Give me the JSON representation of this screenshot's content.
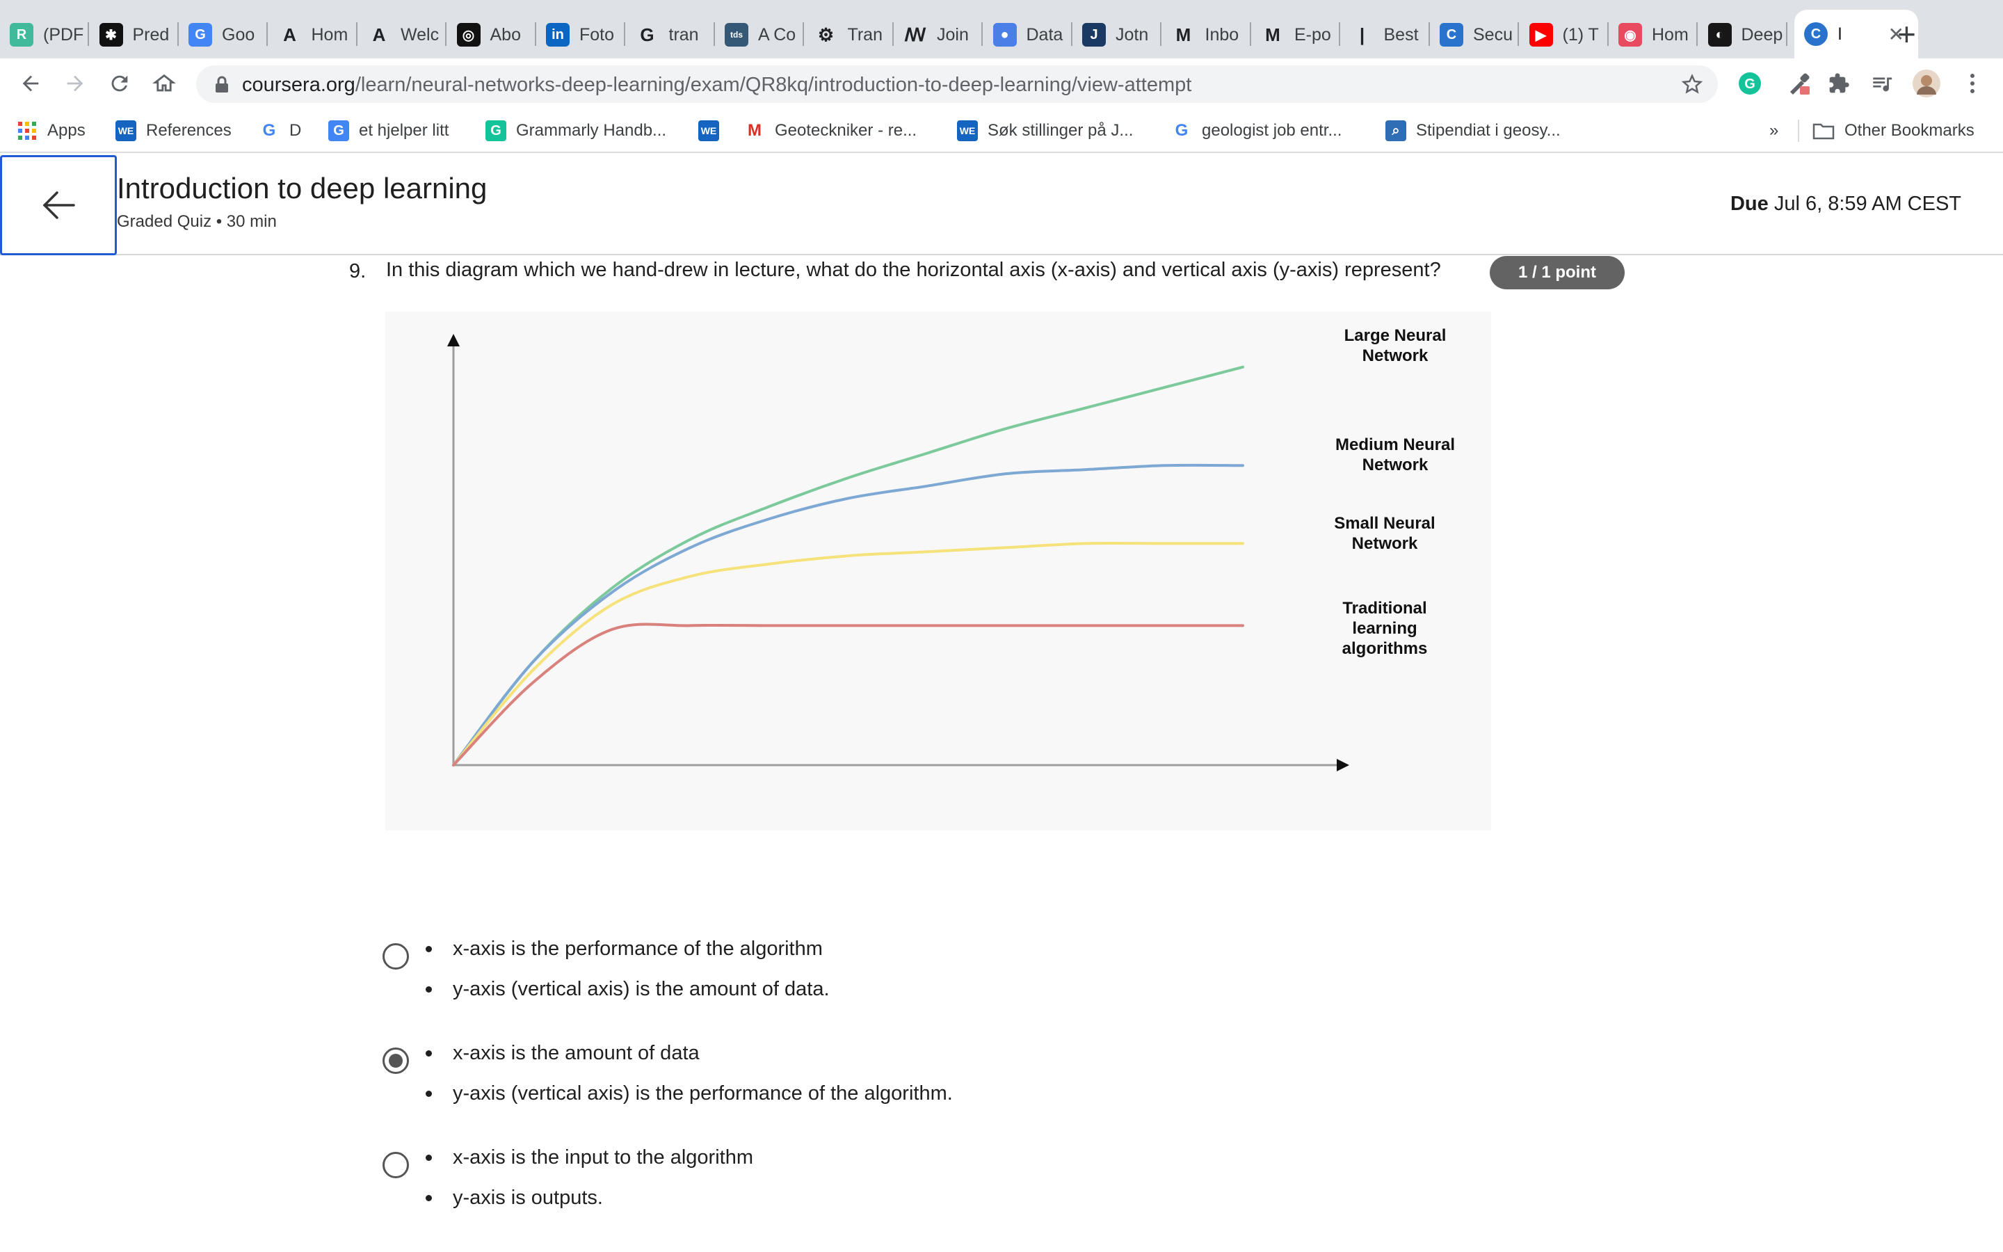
{
  "tabs": [
    {
      "label": "(PDF",
      "icon": "researchgate-icon",
      "color": "#40ba9b",
      "glyph": "R"
    },
    {
      "label": "Pred",
      "icon": "gear-icon",
      "color": "#111111",
      "glyph": "✱"
    },
    {
      "label": "Goo",
      "icon": "google-translate-icon",
      "color": "#4285f4",
      "glyph": "G"
    },
    {
      "label": "Hom",
      "icon": "a-icon",
      "color": "#ffffff",
      "glyph": "A"
    },
    {
      "label": "Welc",
      "icon": "a-icon",
      "color": "#ffffff",
      "glyph": "A"
    },
    {
      "label": "Abo",
      "icon": "openai-icon",
      "color": "#111111",
      "glyph": "◎"
    },
    {
      "label": "Foto",
      "icon": "linkedin-icon",
      "color": "#0a66c2",
      "glyph": "in"
    },
    {
      "label": "tran",
      "icon": "google-icon",
      "color": "#ffffff",
      "glyph": "G"
    },
    {
      "label": "A Co",
      "icon": "tds-icon",
      "color": "#355876",
      "glyph": "tds"
    },
    {
      "label": "Tran",
      "icon": "robot-icon",
      "color": "#ffffff",
      "glyph": "⚙"
    },
    {
      "label": "Join",
      "icon": "s-icon",
      "color": "#ffffff",
      "glyph": "ꟿ"
    },
    {
      "label": "Data",
      "icon": "drop-icon",
      "color": "#4a7fe8",
      "glyph": "●"
    },
    {
      "label": "Jotn",
      "icon": "j-icon",
      "color": "#1b3a63",
      "glyph": "J"
    },
    {
      "label": "Inbo",
      "icon": "gmail-icon",
      "color": "#ffffff",
      "glyph": "M"
    },
    {
      "label": "E-po",
      "icon": "gmail-icon",
      "color": "#ffffff",
      "glyph": "M"
    },
    {
      "label": "Best",
      "icon": "chart-icon",
      "color": "#ffffff",
      "glyph": "|"
    },
    {
      "label": "Secu",
      "icon": "coursera-icon",
      "color": "#2a73cc",
      "glyph": "C"
    },
    {
      "label": "(1) T",
      "icon": "youtube-icon",
      "color": "#ff0000",
      "glyph": "▶"
    },
    {
      "label": "Hom",
      "icon": "circle-icon",
      "color": "#e84a5f",
      "glyph": "◉"
    },
    {
      "label": "Deep",
      "icon": "github-icon",
      "color": "#181717",
      "glyph": "◐"
    }
  ],
  "active_tab": {
    "label": "I",
    "icon": "coursera-icon",
    "color": "#2a73cc",
    "glyph": "C"
  },
  "url": {
    "host": "coursera.org",
    "path": "/learn/neural-networks-deep-learning/exam/QR8kq/introduction-to-deep-learning/view-attempt"
  },
  "bookmarks": [
    {
      "label": "Apps",
      "icon": "apps-grid-icon",
      "color": "#ffffff",
      "glyph": ""
    },
    {
      "label": "References",
      "icon": "we-icon",
      "color": "#1565c0",
      "glyph": "WE"
    },
    {
      "label": "D",
      "icon": "google-icon",
      "color": "#ffffff",
      "glyph": "G"
    },
    {
      "label": "et hjelper litt",
      "icon": "google-translate-icon",
      "color": "#4285f4",
      "glyph": "G"
    },
    {
      "label": "Grammarly Handb...",
      "icon": "grammarly-icon",
      "color": "#15c39a",
      "glyph": "G"
    },
    {
      "label": "",
      "icon": "we-icon",
      "color": "#1565c0",
      "glyph": "WE"
    },
    {
      "label": "Geoteckniker - re...",
      "icon": "gmail-icon",
      "color": "#ffffff",
      "glyph": "M"
    },
    {
      "label": "Søk stillinger på J...",
      "icon": "we-icon",
      "color": "#1565c0",
      "glyph": "WE"
    },
    {
      "label": "geologist job entr...",
      "icon": "google-icon",
      "color": "#ffffff",
      "glyph": "G"
    },
    {
      "label": "Stipendiat i geosy...",
      "icon": "search-icon",
      "color": "#2f6db5",
      "glyph": "⌕"
    }
  ],
  "bookmarks_overflow": "»",
  "other_bookmarks": "Other Bookmarks",
  "header": {
    "title": "Introduction to deep learning",
    "subtitle": "Graded Quiz • 30 min",
    "due_label": "Due",
    "due_value": "Jul 6, 8:59 AM CEST"
  },
  "question": {
    "number": "9.",
    "text": "In this diagram which we hand-drew in lecture, what do the horizontal axis (x-axis) and vertical axis (y-axis) represent?",
    "points": "1 / 1 point"
  },
  "chart_data": {
    "type": "line",
    "title": "",
    "xlabel": "",
    "ylabel": "",
    "x": [
      0,
      0.1,
      0.2,
      0.3,
      0.4,
      0.5,
      0.6,
      0.7,
      0.8,
      0.9,
      1.0
    ],
    "ylim": [
      0,
      1
    ],
    "xlim": [
      0,
      1
    ],
    "grid": false,
    "series": [
      {
        "name": "Large Neural Network",
        "color": "#7cc99c",
        "values": [
          0,
          0.25,
          0.43,
          0.55,
          0.63,
          0.7,
          0.76,
          0.82,
          0.87,
          0.92,
          0.97
        ]
      },
      {
        "name": "Medium Neural Network",
        "color": "#7ea8d4",
        "values": [
          0,
          0.25,
          0.42,
          0.53,
          0.6,
          0.65,
          0.68,
          0.71,
          0.72,
          0.73,
          0.73
        ]
      },
      {
        "name": "Small Neural Network",
        "color": "#f5e27a",
        "values": [
          0,
          0.23,
          0.39,
          0.46,
          0.49,
          0.51,
          0.52,
          0.53,
          0.54,
          0.54,
          0.54
        ]
      },
      {
        "name": "Traditional learning algorithms",
        "color": "#d9817c",
        "values": [
          0,
          0.2,
          0.33,
          0.34,
          0.34,
          0.34,
          0.34,
          0.34,
          0.34,
          0.34,
          0.34
        ]
      }
    ]
  },
  "chart_labels": [
    [
      "Large Neural",
      "Network"
    ],
    [
      "Medium Neural",
      "Network"
    ],
    [
      "Small Neural",
      "Network"
    ],
    [
      "Traditional",
      "learning",
      "algorithms"
    ]
  ],
  "options": [
    {
      "checked": false,
      "lines": [
        "x-axis is the performance of the algorithm",
        "y-axis (vertical axis) is the amount of data."
      ]
    },
    {
      "checked": true,
      "lines": [
        "x-axis is the amount of data",
        "y-axis (vertical axis) is the performance of the algorithm."
      ]
    },
    {
      "checked": false,
      "lines": [
        "x-axis is the input to the algorithm",
        "y-axis is outputs."
      ]
    }
  ],
  "colors": {
    "accent": "#1f5bd6",
    "badge": "#636363"
  }
}
